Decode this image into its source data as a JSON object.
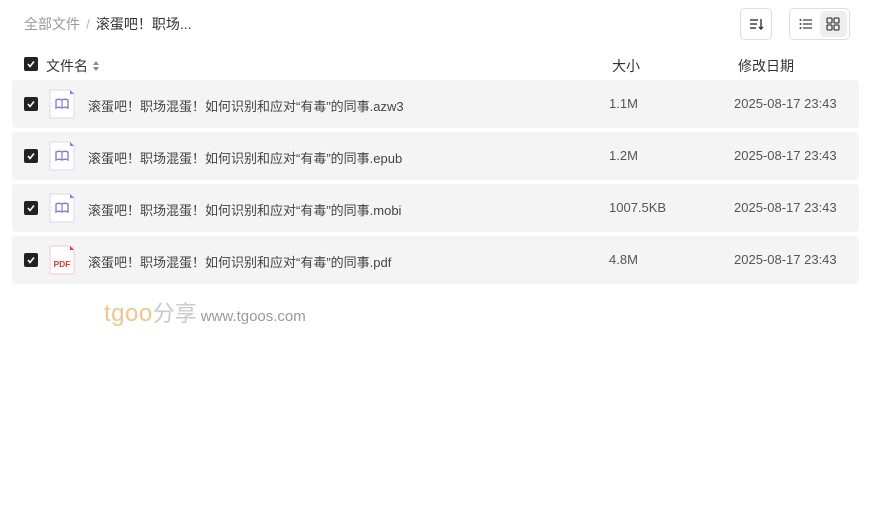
{
  "breadcrumb": {
    "root": "全部文件",
    "separator": "/",
    "current": "滚蛋吧！职场..."
  },
  "toolbar": {
    "sort_icon": "sort-icon",
    "list_view_icon": "list-view-icon",
    "grid_view_icon": "grid-view-icon",
    "active_view": "list"
  },
  "columns": {
    "name": "文件名",
    "size": "大小",
    "date": "修改日期"
  },
  "files": [
    {
      "name": "滚蛋吧！职场混蛋！如何识别和应对“有毒”的同事.azw3",
      "size": "1.1M",
      "date": "2025-08-17 23:43",
      "icon": "ebook-icon",
      "checked": true
    },
    {
      "name": "滚蛋吧！职场混蛋！如何识别和应对“有毒”的同事.epub",
      "size": "1.2M",
      "date": "2025-08-17 23:43",
      "icon": "ebook-icon",
      "checked": true
    },
    {
      "name": "滚蛋吧！职场混蛋！如何识别和应对“有毒”的同事.mobi",
      "size": "1007.5KB",
      "date": "2025-08-17 23:43",
      "icon": "ebook-icon",
      "checked": true
    },
    {
      "name": "滚蛋吧！职场混蛋！如何识别和应对“有毒”的同事.pdf",
      "size": "4.8M",
      "date": "2025-08-17 23:43",
      "icon": "pdf-icon",
      "checked": true
    }
  ],
  "pdf_icon_label": "PDF",
  "watermark": {
    "brand": "tgoo",
    "cn": "分享",
    "url": "www.tgoos.com"
  },
  "colors": {
    "checkbox": "#222222",
    "row_bg": "#f4f4f4",
    "ebook_accent": "#8a7ad8",
    "pdf_accent": "#e53935",
    "watermark_brand": "#f3c58a"
  }
}
